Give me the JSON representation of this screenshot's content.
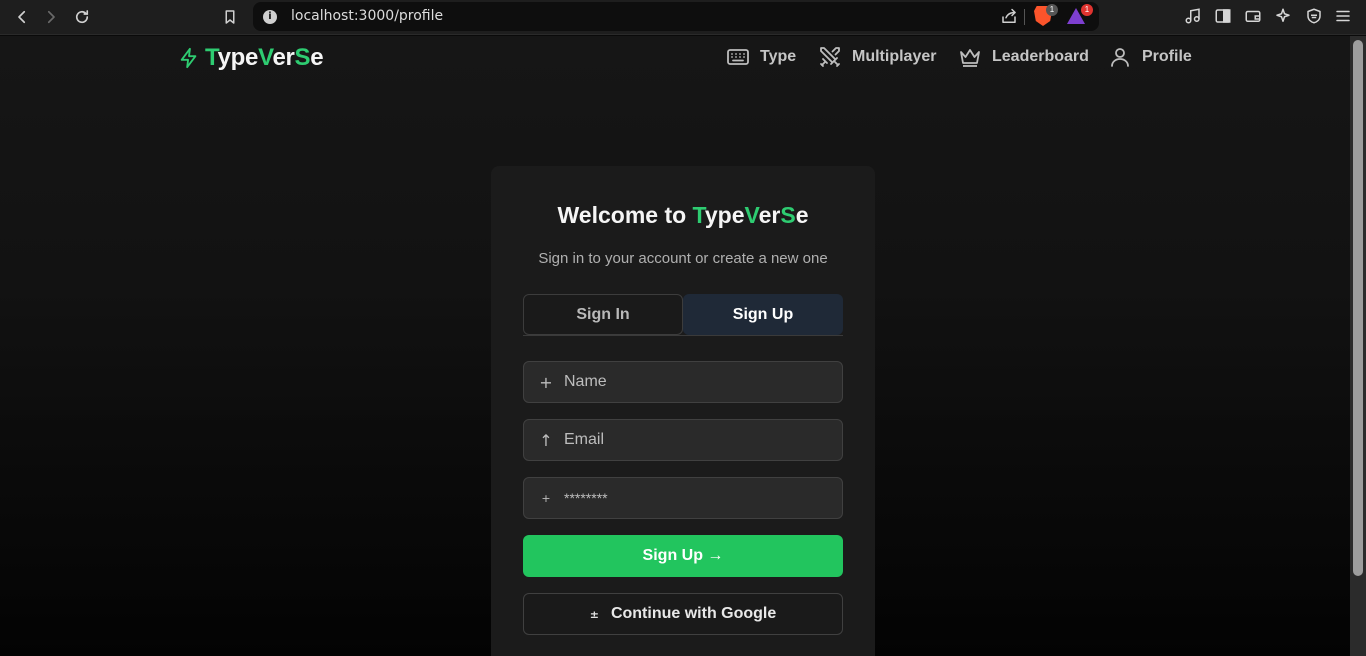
{
  "browser": {
    "url": "localhost:3000/profile",
    "info_glyph": "i",
    "shield_badge": "1",
    "rewards_badge": "1"
  },
  "header": {
    "logo": {
      "p1": "T",
      "p2": "ype",
      "p3": "V",
      "p4": "er",
      "p5": "S",
      "p6": "e"
    },
    "nav": [
      {
        "label": "Type",
        "icon": "keyboard-icon"
      },
      {
        "label": "Multiplayer",
        "icon": "swords-icon"
      },
      {
        "label": "Leaderboard",
        "icon": "crown-icon"
      },
      {
        "label": "Profile",
        "icon": "user-icon"
      }
    ]
  },
  "auth_card": {
    "title_prefix": "Welcome to ",
    "title_brand": {
      "p1": "T",
      "p2": "ype",
      "p3": "V",
      "p4": "er",
      "p5": "S",
      "p6": "e"
    },
    "subtitle": "Sign in to your account or create a new one",
    "tabs": {
      "signin": "Sign In",
      "signup": "Sign Up",
      "active": "signup"
    },
    "fields": {
      "name": {
        "placeholder": "Name",
        "icon": "+"
      },
      "email": {
        "placeholder": "Email",
        "icon": "↑"
      },
      "password": {
        "placeholder": "********",
        "icon": "+"
      }
    },
    "submit_label": "Sign Up →",
    "google_label": "Continue with Google",
    "google_icon": "±"
  },
  "colors": {
    "accent": "#2ecc71",
    "primary_button": "#22c55e",
    "active_tab": "#1f2937",
    "card": "#1b1b1b"
  }
}
